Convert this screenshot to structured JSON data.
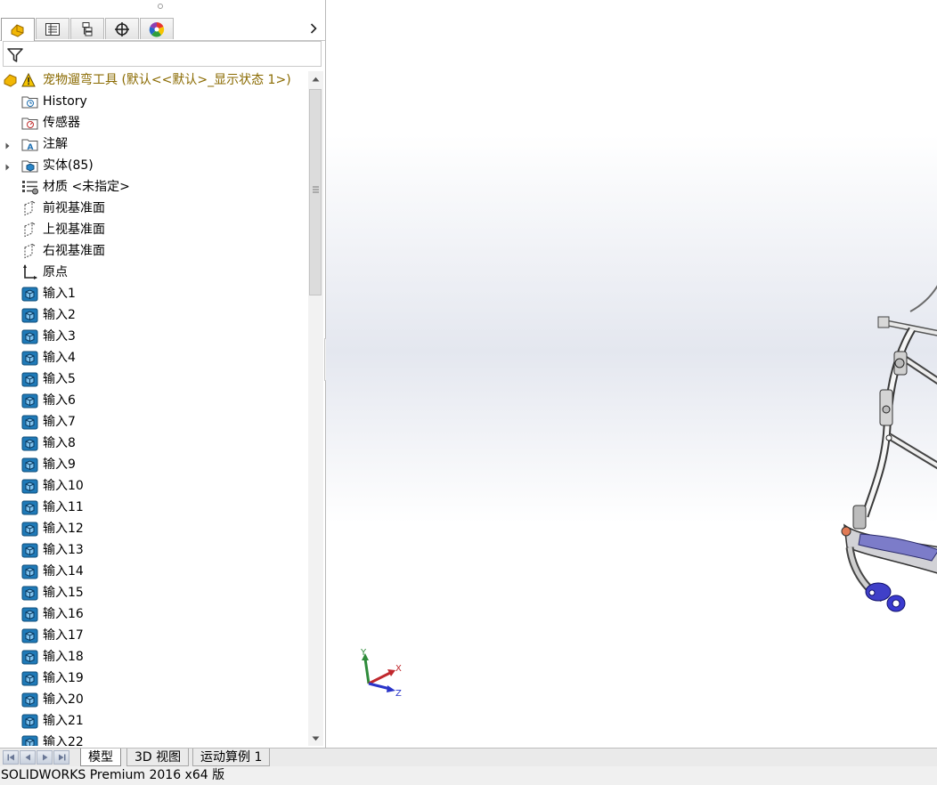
{
  "feature_manager": {
    "tabs": [
      {
        "name": "featuremanager-tab",
        "icon": "featuremanager-icon"
      },
      {
        "name": "propertymanager-tab",
        "icon": "property-list-icon"
      },
      {
        "name": "configurationmanager-tab",
        "icon": "configuration-icon"
      },
      {
        "name": "dimxpertmanager-tab",
        "icon": "crosshair-icon"
      },
      {
        "name": "displaymanager-tab",
        "icon": "color-wheel-icon"
      }
    ],
    "tree": {
      "root": {
        "label": "宠物遛弯工具  (默认<<默认>_显示状态 1>)",
        "icon": "part-warning-icon"
      },
      "items": [
        {
          "label": "History",
          "icon": "history-folder-icon",
          "expandable": false
        },
        {
          "label": "传感器",
          "icon": "sensor-folder-icon",
          "expandable": false
        },
        {
          "label": "注解",
          "icon": "annotation-folder-icon",
          "expandable": true
        },
        {
          "label": "实体(85)",
          "icon": "solid-bodies-folder-icon",
          "expandable": true
        },
        {
          "label": "材质 <未指定>",
          "icon": "material-icon",
          "expandable": false
        },
        {
          "label": "前视基准面",
          "icon": "plane-icon",
          "expandable": false
        },
        {
          "label": "上视基准面",
          "icon": "plane-icon",
          "expandable": false
        },
        {
          "label": "右视基准面",
          "icon": "plane-icon",
          "expandable": false
        },
        {
          "label": "原点",
          "icon": "origin-icon",
          "expandable": false
        },
        {
          "label": "输入1",
          "icon": "imported-body-icon"
        },
        {
          "label": "输入2",
          "icon": "imported-body-icon"
        },
        {
          "label": "输入3",
          "icon": "imported-body-icon"
        },
        {
          "label": "输入4",
          "icon": "imported-body-icon"
        },
        {
          "label": "输入5",
          "icon": "imported-body-icon"
        },
        {
          "label": "输入6",
          "icon": "imported-body-icon"
        },
        {
          "label": "输入7",
          "icon": "imported-body-icon"
        },
        {
          "label": "输入8",
          "icon": "imported-body-icon"
        },
        {
          "label": "输入9",
          "icon": "imported-body-icon"
        },
        {
          "label": "输入10",
          "icon": "imported-body-icon"
        },
        {
          "label": "输入11",
          "icon": "imported-body-icon"
        },
        {
          "label": "输入12",
          "icon": "imported-body-icon"
        },
        {
          "label": "输入13",
          "icon": "imported-body-icon"
        },
        {
          "label": "输入14",
          "icon": "imported-body-icon"
        },
        {
          "label": "输入15",
          "icon": "imported-body-icon"
        },
        {
          "label": "输入16",
          "icon": "imported-body-icon"
        },
        {
          "label": "输入17",
          "icon": "imported-body-icon"
        },
        {
          "label": "输入18",
          "icon": "imported-body-icon"
        },
        {
          "label": "输入19",
          "icon": "imported-body-icon"
        },
        {
          "label": "输入20",
          "icon": "imported-body-icon"
        },
        {
          "label": "输入21",
          "icon": "imported-body-icon"
        },
        {
          "label": "输入22",
          "icon": "imported-body-icon"
        }
      ]
    }
  },
  "viewport": {
    "triad": {
      "x_label": "X",
      "y_label": "Y",
      "z_label": "Z"
    },
    "colors": {
      "x_axis": "#c0282d",
      "y_axis": "#2e8b3a",
      "z_axis": "#2a35c9"
    }
  },
  "bottom_tabs": [
    {
      "label": "模型",
      "active": true
    },
    {
      "label": "3D 视图",
      "active": false
    },
    {
      "label": "运动算例 1",
      "active": false
    }
  ],
  "status_bar": {
    "text": "SOLIDWORKS Premium 2016 x64 版"
  },
  "colors": {
    "root_label": "#8a6a00",
    "body_icon": "#1f7ab8",
    "panel_border": "#b9b9b9"
  }
}
